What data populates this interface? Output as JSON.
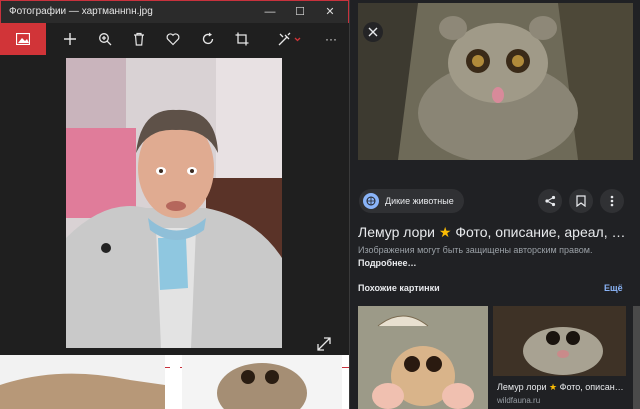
{
  "viewer": {
    "title": "Фотографии — хартманнnн.jpg",
    "window_buttons": {
      "minimize": "—",
      "maximize": "☐",
      "close": "✕"
    },
    "toolbar_icons": [
      "app-photos-icon",
      "add-icon",
      "zoom-icon",
      "delete-icon",
      "heart-icon",
      "rotate-icon",
      "crop-icon",
      "edit-icon",
      "more-icon"
    ],
    "more_label": "···"
  },
  "search_panel": {
    "close_icon": "close-icon",
    "chip_label": "Дикие животные",
    "heading": "Лемур лори",
    "heading_suffix": "Фото, описание, ареал, …",
    "copyright_text": "Изображения могут быть защищены авторским правом.",
    "copyright_more": "Подробнее…",
    "similar_title": "Похожие картинки",
    "similar_more": "Ещё",
    "result_caption_name": "Лемур лори",
    "result_caption_suffix": "Фото, описан…",
    "result_source": "wildfauna.ru"
  },
  "colors": {
    "accent_red": "#d13438",
    "link_blue": "#8ab4f8",
    "star": "#fbbc04"
  }
}
